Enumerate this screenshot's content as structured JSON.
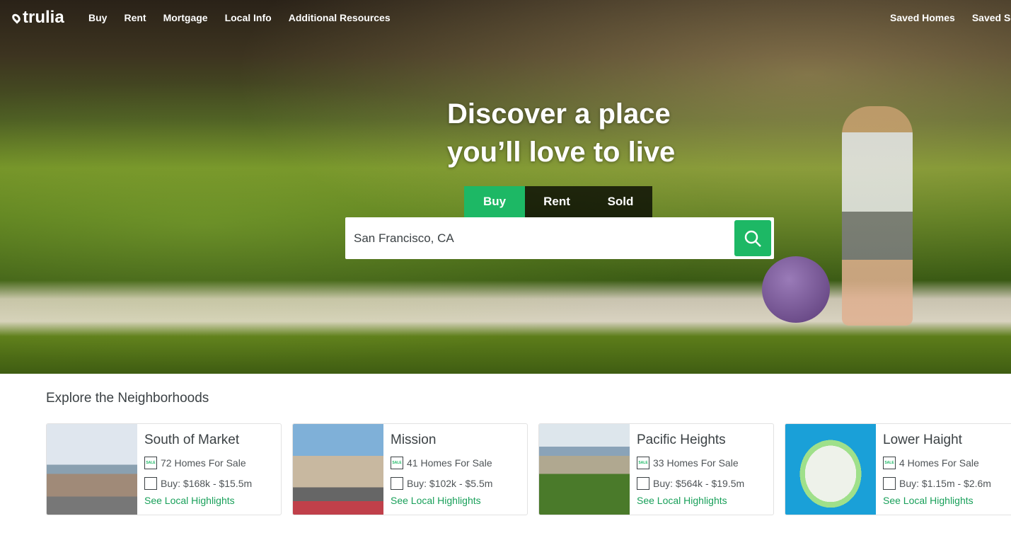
{
  "nav": {
    "logo": "trulia",
    "links": [
      "Buy",
      "Rent",
      "Mortgage",
      "Local Info",
      "Additional Resources"
    ],
    "right": [
      "Saved Homes",
      "Saved Searches"
    ]
  },
  "hero": {
    "headline_1": "Discover a place",
    "headline_2": "you’ll love to live",
    "tabs": [
      "Buy",
      "Rent",
      "Sold"
    ],
    "active_tab": "Buy",
    "search_value": "San Francisco, CA",
    "accent": "#1db865"
  },
  "neighborhoods": {
    "title": "Explore the Neighborhoods",
    "icon_text": "SALE",
    "cards": [
      {
        "name": "South of Market",
        "homes": "72 Homes For Sale",
        "price": "Buy: $168k - $15.5m",
        "link": "See Local Highlights"
      },
      {
        "name": "Mission",
        "homes": "41 Homes For Sale",
        "price": "Buy: $102k - $5.5m",
        "link": "See Local Highlights"
      },
      {
        "name": "Pacific Heights",
        "homes": "33 Homes For Sale",
        "price": "Buy: $564k - $19.5m",
        "link": "See Local Highlights"
      },
      {
        "name": "Lower Haight",
        "homes": "4 Homes For Sale",
        "price": "Buy: $1.15m - $2.6m",
        "link": "See Local Highlights"
      }
    ]
  }
}
